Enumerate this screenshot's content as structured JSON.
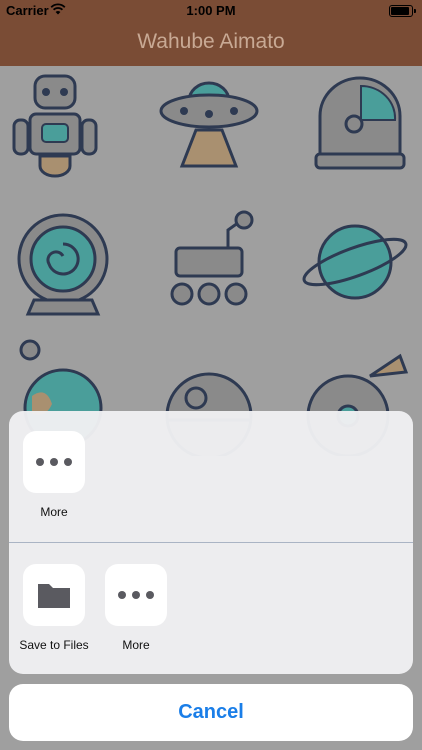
{
  "status_bar": {
    "carrier": "Carrier",
    "time": "1:00 PM"
  },
  "nav": {
    "title": "Wahube Aimato"
  },
  "share_sheet": {
    "row1": [
      {
        "label": "More",
        "icon": "ellipsis-icon"
      }
    ],
    "row2": [
      {
        "label": "Save to Files",
        "icon": "folder-icon"
      },
      {
        "label": "More",
        "icon": "ellipsis-icon"
      }
    ],
    "cancel_label": "Cancel"
  },
  "colors": {
    "nav_bar": "#7a4c35",
    "title_text": "#c8a994",
    "accent_blue": "#1a7ee8",
    "icon_teal": "#4a9e9a",
    "icon_outline": "#2e3a52"
  },
  "background_icons": [
    "robot-icon",
    "ufo-icon",
    "astronaut-helmet-icon",
    "portal-icon",
    "mars-rover-icon",
    "ringed-planet-icon",
    "earth-icon",
    "death-star-icon",
    "spaceship-icon"
  ]
}
